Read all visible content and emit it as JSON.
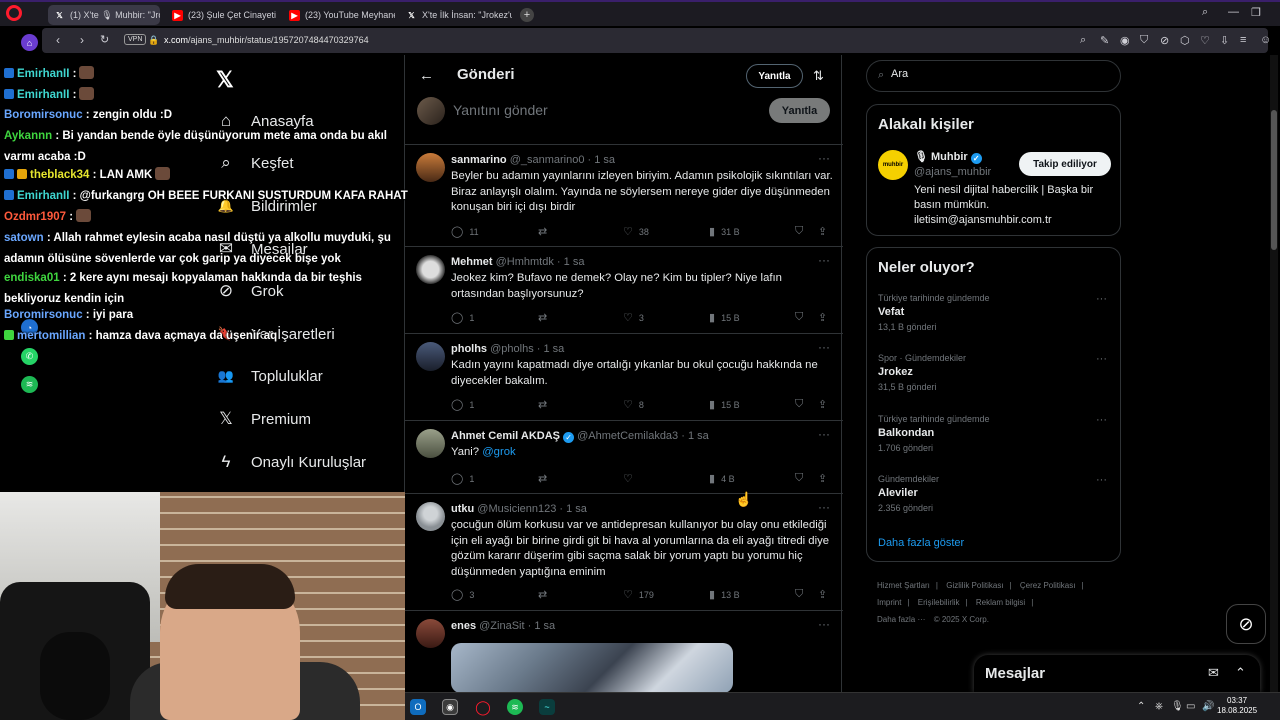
{
  "browser": {
    "tabs": [
      {
        "label": "(1) X'te 🎙 Muhbir: \"Jroke…",
        "icon": "x-icon",
        "active": true
      },
      {
        "label": "(23) Şule Çet Cinayeti - Kı",
        "icon": "youtube-icon",
        "active": false
      },
      {
        "label": "(23) YouTube Meyhanesi (",
        "icon": "youtube-icon",
        "active": false
      },
      {
        "label": "X'te İlk İnsan: \"Jrokez'un d",
        "icon": "x-icon",
        "active": false
      }
    ],
    "vpn_label": "VPN",
    "url_host": "x.com",
    "url_path": "/ajans_muhbir/status/1957207484470329764"
  },
  "chat": [
    {
      "user": "EmirhanII",
      "color": "#3fd6d0",
      "text": " :",
      "emote": true
    },
    {
      "user": "EmirhanII",
      "color": "#3fd6d0",
      "text": " :",
      "emote": true
    },
    {
      "user": "Boromirsonuc",
      "color": "#6aa7ff",
      "text": " : zengin oldu :D"
    },
    {
      "user": "Aykannn",
      "color": "#3fd63f",
      "text": " : Bi yandan bende öyle düşünüyorum mete ama onda bu akıl varmı acaba :D"
    },
    {
      "user": "theblack34",
      "color": "#e5e52e",
      "text": " : LAN AMK",
      "emote": true
    },
    {
      "user": "EmirhanII",
      "color": "#3fd6d0",
      "text": " : @furkangrg OH BEEE FURKANI SUSTURDUM KAFA RAHAT"
    },
    {
      "user": "Ozdmr1907",
      "color": "#ff5a3c",
      "text": " :",
      "emote": true
    },
    {
      "user": "satown",
      "color": "#6aa7ff",
      "text": " : Allah rahmet eylesin acaba nasıl düştü ya alkollu muyduki, şu adamın ölüsüne sövenlerde var çok garip ya diyecek bişe yok"
    },
    {
      "user": "endiska01",
      "color": "#3fd63f",
      "text": " : 2 kere aynı mesajı kopyalaman hakkında da bir teşhis bekliyoruz kendin için"
    },
    {
      "user": "Boromirsonuc",
      "color": "#6aa7ff",
      "text": " : iyi para"
    },
    {
      "user": "mertomillian",
      "color": "#6aa7ff",
      "text": " : hamza dava açmaya da üşenir aq"
    }
  ],
  "nav": {
    "items": [
      {
        "label": "Anasayfa",
        "icon": "home-icon",
        "glyph": "⌂"
      },
      {
        "label": "Keşfet",
        "icon": "search-icon",
        "glyph": "⌕"
      },
      {
        "label": "Bildirimler",
        "icon": "bell-icon",
        "glyph": "🔔"
      },
      {
        "label": "Mesajlar",
        "icon": "mail-icon",
        "glyph": "✉"
      },
      {
        "label": "Grok",
        "icon": "grok-icon",
        "glyph": "⊘"
      },
      {
        "label": "Yer İşaretleri",
        "icon": "bookmark-icon",
        "glyph": "🔖"
      },
      {
        "label": "Topluluklar",
        "icon": "communities-icon",
        "glyph": "👥"
      },
      {
        "label": "Premium",
        "icon": "x-premium-icon",
        "glyph": "𝕏"
      },
      {
        "label": "Onaylı Kuruluşlar",
        "icon": "lightning-icon",
        "glyph": "ϟ"
      }
    ]
  },
  "header": {
    "title": "Gönderi",
    "reply_label": "Yanıtla"
  },
  "compose": {
    "placeholder": "Yanıtını gönder",
    "button": "Yanıtla"
  },
  "tweets": [
    {
      "name": "sanmarino",
      "handle": "@_sanmarino0",
      "time": "· 1 sa",
      "text": "Beyler bu adamın yayınlarını izleyen biriyim. Adamın psikolojik sıkıntıları var. Biraz anlayışlı olalım. Yayında ne söylersem nereye gider diye düşünmeden konuşan biri içi dışı birdir",
      "replies": "11",
      "likes": "38",
      "views": "31 B",
      "verified": false
    },
    {
      "name": "Mehmet",
      "handle": "@Hmhmtdk",
      "time": "· 1 sa",
      "text": "Jeokez kim? Bufavo ne demek? Olay ne? Kim bu tipler? Niye lafın ortasından başlıyorsunuz?",
      "replies": "1",
      "likes": "3",
      "views": "15 B",
      "verified": false
    },
    {
      "name": "pholhs",
      "handle": "@pholhs",
      "time": "· 1 sa",
      "text": "Kadın yayını kapatmadı diye ortalığı yıkanlar bu okul çocuğu hakkında ne diyecekler bakalım.",
      "replies": "1",
      "likes": "8",
      "views": "15 B",
      "verified": false
    },
    {
      "name": "Ahmet Cemil AKDAŞ",
      "handle": "@AhmetCemilakda3",
      "time": "· 1 sa",
      "text": "Yani? ",
      "link": "@grok",
      "replies": "1",
      "likes": "",
      "views": "4 B",
      "verified": true
    },
    {
      "name": "utku",
      "handle": "@Musicienn123",
      "time": "· 1 sa",
      "text": "çocuğun ölüm korkusu var ve antidepresan kullanıyor bu olay onu etkilediği için eli ayağı bir birine girdi git bi hava al yorumlarına da eli ayağı titredi diye gözüm kararır düşerim gibi saçma salak bir yorum yaptı bu yorumu hiç düşünmeden yaptığına eminim",
      "replies": "3",
      "likes": "179",
      "views": "13 B",
      "verified": false
    },
    {
      "name": "enes",
      "handle": "@ZinaSit",
      "time": "· 1 sa",
      "text": "",
      "replies": "",
      "likes": "",
      "views": "",
      "verified": false
    }
  ],
  "search": {
    "placeholder": "Ara"
  },
  "related": {
    "title": "Alakalı kişiler",
    "avatar_text": "muhbir",
    "name": "🎙 Muhbir",
    "handle": "@ajans_muhbir",
    "bio": "Yeni nesil dijital habercilik | Başka bir basın mümkün. iletisim@ajansmuhbir.com.tr",
    "follow_label": "Takip ediliyor"
  },
  "trends": {
    "title": "Neler oluyor?",
    "items": [
      {
        "context": "Türkiye tarihinde gündemde",
        "topic": "Vefat",
        "count": "13,1 B gönderi"
      },
      {
        "context": "Spor · Gündemdekiler",
        "topic": "Jrokez",
        "count": "31,5 B gönderi"
      },
      {
        "context": "Türkiye tarihinde gündemde",
        "topic": "Balkondan",
        "count": "1.706 gönderi"
      },
      {
        "context": "Gündemdekiler",
        "topic": "Aleviler",
        "count": "2.356 gönderi"
      }
    ],
    "show_more": "Daha fazla göster"
  },
  "footer": {
    "links": [
      "Hizmet Şartları",
      "|",
      "Gizlilik Politikası",
      "|",
      "Çerez Politikası",
      "|",
      "Imprint",
      "|",
      "Erişilebilirlik",
      "|",
      "Reklam bilgisi",
      "|",
      "Daha fazla ···",
      "© 2025 X Corp."
    ]
  },
  "messages": {
    "title": "Mesajlar"
  },
  "taskbar": {
    "time": "03:37",
    "date": "18.08.2025"
  },
  "colors": {
    "accent": "#1d9bf0",
    "background": "#000000",
    "border": "#2f3336",
    "muted": "#71767b"
  }
}
